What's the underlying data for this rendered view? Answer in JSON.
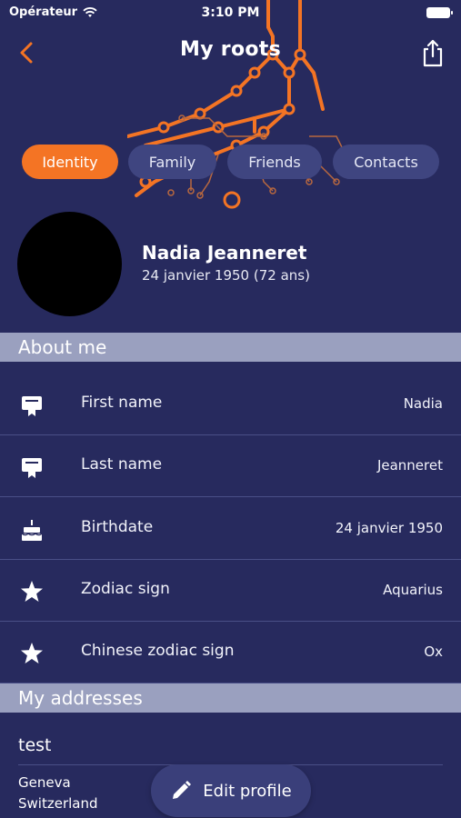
{
  "status_bar": {
    "carrier": "Opérateur",
    "time": "3:10 PM"
  },
  "header": {
    "title": "My roots"
  },
  "tabs": [
    {
      "label": "Identity",
      "active": true
    },
    {
      "label": "Family",
      "active": false
    },
    {
      "label": "Friends",
      "active": false
    },
    {
      "label": "Contacts",
      "active": false
    }
  ],
  "profile": {
    "name": "Nadia Jeanneret",
    "birth": "24 janvier 1950 (72 ans)"
  },
  "about": {
    "header": "About me",
    "rows": [
      {
        "icon": "badge-icon",
        "label": "First name",
        "value": "Nadia"
      },
      {
        "icon": "badge-icon",
        "label": "Last name",
        "value": "Jeanneret"
      },
      {
        "icon": "birthday-cake-icon",
        "label": "Birthdate",
        "value": "24 janvier 1950"
      },
      {
        "icon": "star-icon",
        "label": "Zodiac sign",
        "value": "Aquarius"
      },
      {
        "icon": "star-icon",
        "label": "Chinese zodiac sign",
        "value": "Ox"
      }
    ]
  },
  "addresses": {
    "header": "My addresses",
    "items": [
      {
        "title": "test",
        "lines": [
          "Geneva",
          "Switzerland"
        ]
      }
    ]
  },
  "edit_button": {
    "label": "Edit profile",
    "icon": "pencil-icon"
  },
  "colors": {
    "background": "#272a5e",
    "accent": "#f47424",
    "tab_inactive": "#3f4580",
    "section_header": "#9aa0bf"
  }
}
